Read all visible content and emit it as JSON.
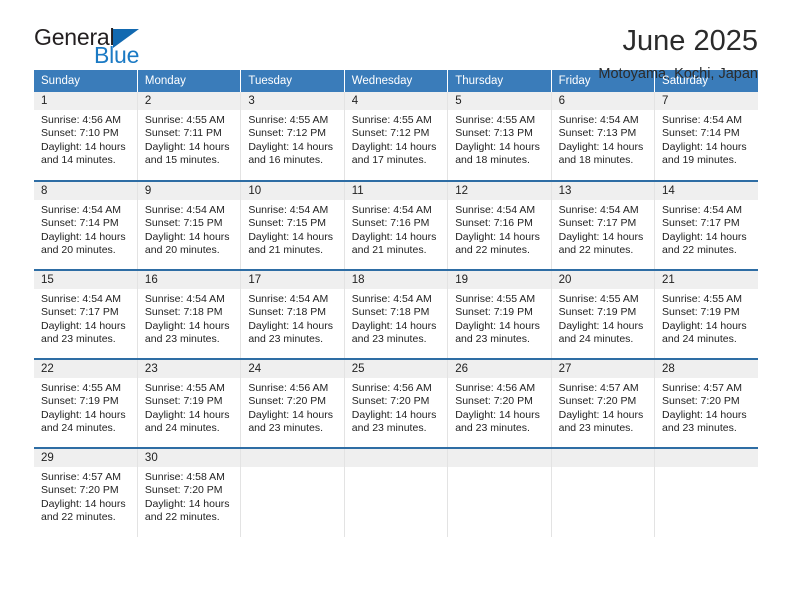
{
  "brand": {
    "line1": "General",
    "line2": "Blue",
    "triangle_color": "#1269b0",
    "blue_text_color": "#1b7ac4"
  },
  "header": {
    "title": "June 2025",
    "location": "Motoyama, Kochi, Japan"
  },
  "colors": {
    "header_row_bg": "#3a7cba",
    "week_separator": "#2e6da4",
    "daynum_bg": "#efefef"
  },
  "weekday_headers": [
    "Sunday",
    "Monday",
    "Tuesday",
    "Wednesday",
    "Thursday",
    "Friday",
    "Saturday"
  ],
  "labels": {
    "sunrise_prefix": "Sunrise:",
    "sunset_prefix": "Sunset:",
    "daylight_prefix": "Daylight:"
  },
  "weeks": [
    [
      {
        "day": "1",
        "sunrise": "Sunrise: 4:56 AM",
        "sunset": "Sunset: 7:10 PM",
        "daylight1": "Daylight: 14 hours",
        "daylight2": "and 14 minutes."
      },
      {
        "day": "2",
        "sunrise": "Sunrise: 4:55 AM",
        "sunset": "Sunset: 7:11 PM",
        "daylight1": "Daylight: 14 hours",
        "daylight2": "and 15 minutes."
      },
      {
        "day": "3",
        "sunrise": "Sunrise: 4:55 AM",
        "sunset": "Sunset: 7:12 PM",
        "daylight1": "Daylight: 14 hours",
        "daylight2": "and 16 minutes."
      },
      {
        "day": "4",
        "sunrise": "Sunrise: 4:55 AM",
        "sunset": "Sunset: 7:12 PM",
        "daylight1": "Daylight: 14 hours",
        "daylight2": "and 17 minutes."
      },
      {
        "day": "5",
        "sunrise": "Sunrise: 4:55 AM",
        "sunset": "Sunset: 7:13 PM",
        "daylight1": "Daylight: 14 hours",
        "daylight2": "and 18 minutes."
      },
      {
        "day": "6",
        "sunrise": "Sunrise: 4:54 AM",
        "sunset": "Sunset: 7:13 PM",
        "daylight1": "Daylight: 14 hours",
        "daylight2": "and 18 minutes."
      },
      {
        "day": "7",
        "sunrise": "Sunrise: 4:54 AM",
        "sunset": "Sunset: 7:14 PM",
        "daylight1": "Daylight: 14 hours",
        "daylight2": "and 19 minutes."
      }
    ],
    [
      {
        "day": "8",
        "sunrise": "Sunrise: 4:54 AM",
        "sunset": "Sunset: 7:14 PM",
        "daylight1": "Daylight: 14 hours",
        "daylight2": "and 20 minutes."
      },
      {
        "day": "9",
        "sunrise": "Sunrise: 4:54 AM",
        "sunset": "Sunset: 7:15 PM",
        "daylight1": "Daylight: 14 hours",
        "daylight2": "and 20 minutes."
      },
      {
        "day": "10",
        "sunrise": "Sunrise: 4:54 AM",
        "sunset": "Sunset: 7:15 PM",
        "daylight1": "Daylight: 14 hours",
        "daylight2": "and 21 minutes."
      },
      {
        "day": "11",
        "sunrise": "Sunrise: 4:54 AM",
        "sunset": "Sunset: 7:16 PM",
        "daylight1": "Daylight: 14 hours",
        "daylight2": "and 21 minutes."
      },
      {
        "day": "12",
        "sunrise": "Sunrise: 4:54 AM",
        "sunset": "Sunset: 7:16 PM",
        "daylight1": "Daylight: 14 hours",
        "daylight2": "and 22 minutes."
      },
      {
        "day": "13",
        "sunrise": "Sunrise: 4:54 AM",
        "sunset": "Sunset: 7:17 PM",
        "daylight1": "Daylight: 14 hours",
        "daylight2": "and 22 minutes."
      },
      {
        "day": "14",
        "sunrise": "Sunrise: 4:54 AM",
        "sunset": "Sunset: 7:17 PM",
        "daylight1": "Daylight: 14 hours",
        "daylight2": "and 22 minutes."
      }
    ],
    [
      {
        "day": "15",
        "sunrise": "Sunrise: 4:54 AM",
        "sunset": "Sunset: 7:17 PM",
        "daylight1": "Daylight: 14 hours",
        "daylight2": "and 23 minutes."
      },
      {
        "day": "16",
        "sunrise": "Sunrise: 4:54 AM",
        "sunset": "Sunset: 7:18 PM",
        "daylight1": "Daylight: 14 hours",
        "daylight2": "and 23 minutes."
      },
      {
        "day": "17",
        "sunrise": "Sunrise: 4:54 AM",
        "sunset": "Sunset: 7:18 PM",
        "daylight1": "Daylight: 14 hours",
        "daylight2": "and 23 minutes."
      },
      {
        "day": "18",
        "sunrise": "Sunrise: 4:54 AM",
        "sunset": "Sunset: 7:18 PM",
        "daylight1": "Daylight: 14 hours",
        "daylight2": "and 23 minutes."
      },
      {
        "day": "19",
        "sunrise": "Sunrise: 4:55 AM",
        "sunset": "Sunset: 7:19 PM",
        "daylight1": "Daylight: 14 hours",
        "daylight2": "and 23 minutes."
      },
      {
        "day": "20",
        "sunrise": "Sunrise: 4:55 AM",
        "sunset": "Sunset: 7:19 PM",
        "daylight1": "Daylight: 14 hours",
        "daylight2": "and 24 minutes."
      },
      {
        "day": "21",
        "sunrise": "Sunrise: 4:55 AM",
        "sunset": "Sunset: 7:19 PM",
        "daylight1": "Daylight: 14 hours",
        "daylight2": "and 24 minutes."
      }
    ],
    [
      {
        "day": "22",
        "sunrise": "Sunrise: 4:55 AM",
        "sunset": "Sunset: 7:19 PM",
        "daylight1": "Daylight: 14 hours",
        "daylight2": "and 24 minutes."
      },
      {
        "day": "23",
        "sunrise": "Sunrise: 4:55 AM",
        "sunset": "Sunset: 7:19 PM",
        "daylight1": "Daylight: 14 hours",
        "daylight2": "and 24 minutes."
      },
      {
        "day": "24",
        "sunrise": "Sunrise: 4:56 AM",
        "sunset": "Sunset: 7:20 PM",
        "daylight1": "Daylight: 14 hours",
        "daylight2": "and 23 minutes."
      },
      {
        "day": "25",
        "sunrise": "Sunrise: 4:56 AM",
        "sunset": "Sunset: 7:20 PM",
        "daylight1": "Daylight: 14 hours",
        "daylight2": "and 23 minutes."
      },
      {
        "day": "26",
        "sunrise": "Sunrise: 4:56 AM",
        "sunset": "Sunset: 7:20 PM",
        "daylight1": "Daylight: 14 hours",
        "daylight2": "and 23 minutes."
      },
      {
        "day": "27",
        "sunrise": "Sunrise: 4:57 AM",
        "sunset": "Sunset: 7:20 PM",
        "daylight1": "Daylight: 14 hours",
        "daylight2": "and 23 minutes."
      },
      {
        "day": "28",
        "sunrise": "Sunrise: 4:57 AM",
        "sunset": "Sunset: 7:20 PM",
        "daylight1": "Daylight: 14 hours",
        "daylight2": "and 23 minutes."
      }
    ],
    [
      {
        "day": "29",
        "sunrise": "Sunrise: 4:57 AM",
        "sunset": "Sunset: 7:20 PM",
        "daylight1": "Daylight: 14 hours",
        "daylight2": "and 22 minutes."
      },
      {
        "day": "30",
        "sunrise": "Sunrise: 4:58 AM",
        "sunset": "Sunset: 7:20 PM",
        "daylight1": "Daylight: 14 hours",
        "daylight2": "and 22 minutes."
      },
      {
        "day": "",
        "sunrise": "",
        "sunset": "",
        "daylight1": "",
        "daylight2": ""
      },
      {
        "day": "",
        "sunrise": "",
        "sunset": "",
        "daylight1": "",
        "daylight2": ""
      },
      {
        "day": "",
        "sunrise": "",
        "sunset": "",
        "daylight1": "",
        "daylight2": ""
      },
      {
        "day": "",
        "sunrise": "",
        "sunset": "",
        "daylight1": "",
        "daylight2": ""
      },
      {
        "day": "",
        "sunrise": "",
        "sunset": "",
        "daylight1": "",
        "daylight2": ""
      }
    ]
  ]
}
